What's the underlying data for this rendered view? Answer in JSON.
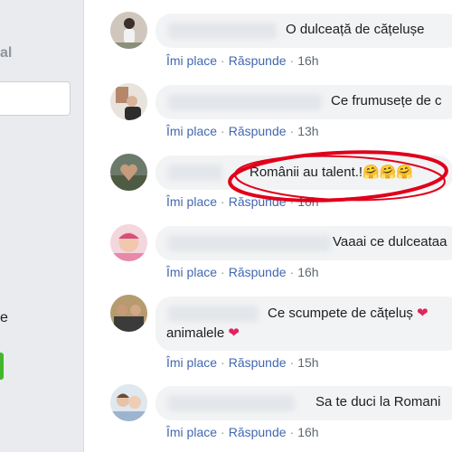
{
  "sidebar": {
    "partial_label_1": "al",
    "partial_label_2": "e"
  },
  "actions": {
    "like": "Îmi place",
    "reply": "Răspunde",
    "separator": "·"
  },
  "comments": [
    {
      "text": "O dulceață de cățelușe",
      "time": "16h"
    },
    {
      "text": "Ce frumusețe de c",
      "time": "13h"
    },
    {
      "text": "Românii au talent.!🤗🤗🤗",
      "time": "16h"
    },
    {
      "text": "Vaaai ce dulceataa",
      "time": "16h"
    },
    {
      "text": "Ce scumpete de cățeluș ❤",
      "text_line2": "animalele ❤",
      "time": "15h"
    },
    {
      "text": "Sa te duci la Romani",
      "time": "16h"
    }
  ],
  "colors": {
    "link": "#4267b2",
    "bubble": "#f2f3f5",
    "annotation_circle": "#e0001a",
    "heart": "#e0245e"
  }
}
